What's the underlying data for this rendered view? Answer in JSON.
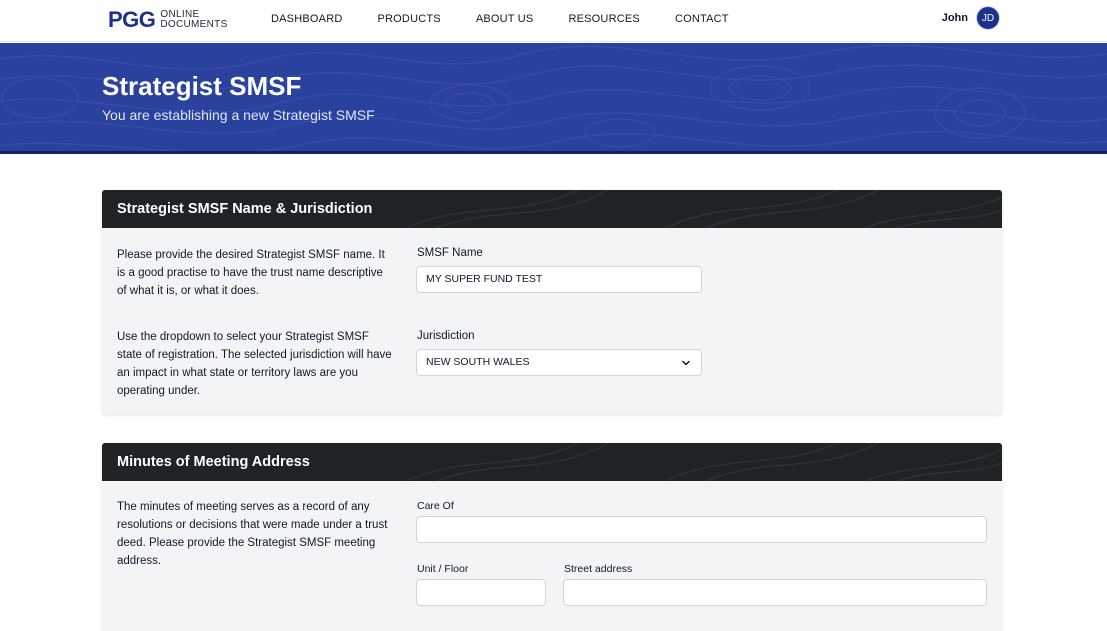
{
  "brand": {
    "logo_mark": "PGG",
    "logo_line1": "ONLINE",
    "logo_line2": "DOCUMENTS"
  },
  "nav": {
    "links": [
      "DASHBOARD",
      "PRODUCTS",
      "ABOUT US",
      "RESOURCES",
      "CONTACT"
    ],
    "user_name": "John",
    "avatar_initials": "JD"
  },
  "hero": {
    "title": "Strategist SMSF",
    "subtitle": "You are establishing a new Strategist SMSF"
  },
  "section_name": {
    "header": "Strategist SMSF Name & Jurisdiction",
    "name_help": "Please provide the desired Strategist SMSF name. It is a good practise to have the trust name descriptive of what it is, or what it does.",
    "name_label": "SMSF Name",
    "name_value": "MY SUPER FUND TEST",
    "jurisdiction_help": "Use the dropdown to select your Strategist SMSF state of registration. The selected jurisdiction will have an impact in what state or territory laws are you operating under.",
    "jurisdiction_label": "Jurisdiction",
    "jurisdiction_value": "NEW SOUTH WALES"
  },
  "section_address": {
    "header": "Minutes of Meeting Address",
    "help": "The minutes of meeting serves as a record of any resolutions or decisions that were made under a trust deed. Please provide the Strategist SMSF meeting address.",
    "care_of_label": "Care Of",
    "care_of_value": "",
    "unit_label": "Unit / Floor",
    "unit_value": "",
    "street_label": "Street address",
    "street_value": ""
  },
  "colors": {
    "brand_blue": "#1e2f8c",
    "hero_blue": "#2b419e",
    "card_header": "#1f2326",
    "card_body": "#f3f4f6"
  },
  "icons": {
    "dropdown": "chevron-down-icon"
  }
}
